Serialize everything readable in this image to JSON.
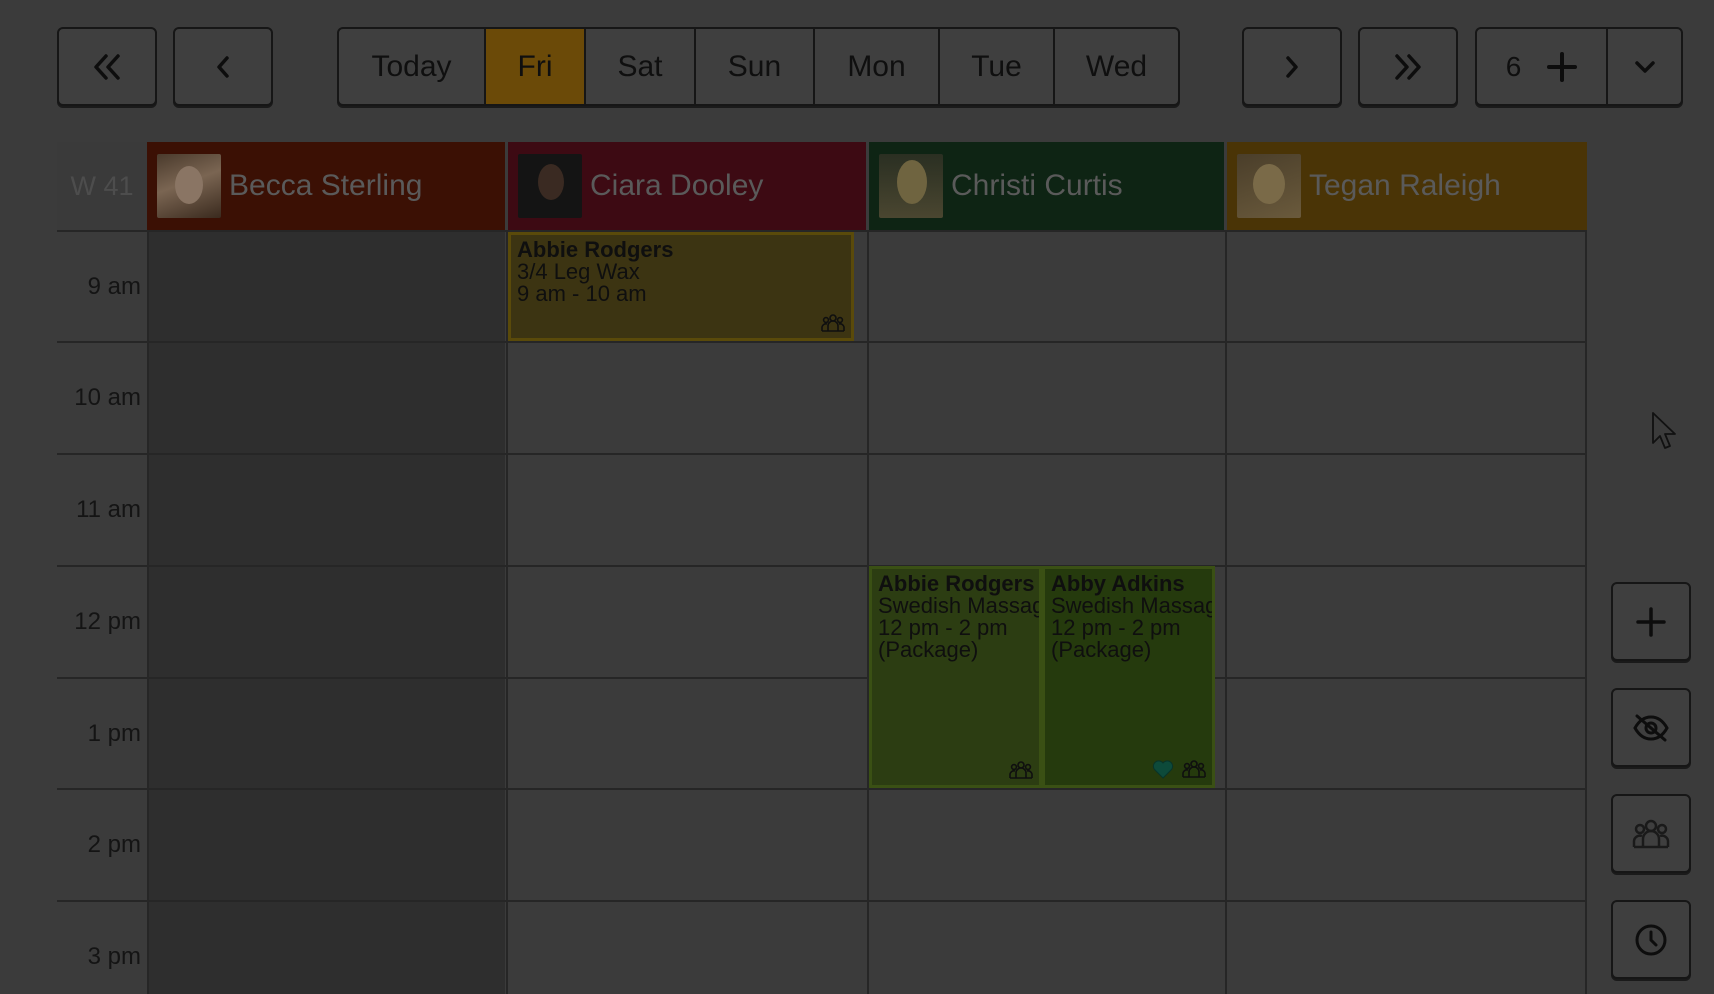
{
  "toolbar": {
    "first_icon": "double-chevron-left-icon",
    "prev_icon": "chevron-left-icon",
    "next_icon": "chevron-right-icon",
    "last_icon": "double-chevron-right-icon",
    "days": [
      {
        "label": "Today",
        "active": false
      },
      {
        "label": "Fri",
        "active": true
      },
      {
        "label": "Sat",
        "active": false
      },
      {
        "label": "Sun",
        "active": false
      },
      {
        "label": "Mon",
        "active": false
      },
      {
        "label": "Tue",
        "active": false
      },
      {
        "label": "Wed",
        "active": false
      }
    ],
    "day_count": "6",
    "add_icon": "plus-icon",
    "dropdown_icon": "chevron-down-icon"
  },
  "calendar": {
    "week_label": "W 41",
    "staff": [
      {
        "name": "Becca Sterling",
        "color": "#3b1004"
      },
      {
        "name": "Ciara Dooley",
        "color": "#3d0a13"
      },
      {
        "name": "Christi Curtis",
        "color": "#0e2414"
      },
      {
        "name": "Tegan Raleigh",
        "color": "#4a3406"
      }
    ],
    "times": [
      "9 am",
      "10 am",
      "11 am",
      "12 pm",
      "1 pm",
      "2 pm",
      "3 pm"
    ],
    "appointments": [
      {
        "client": "Abbie Rodgers",
        "service": "3/4 Leg Wax",
        "time": "9 am - 10 am",
        "note": "",
        "bg": "#3c3412",
        "border": "#5a4a0a",
        "icons": [
          "group-icon"
        ]
      },
      {
        "client": "Abbie Rodgers",
        "service": "Swedish Massage",
        "time": "12 pm - 2 pm",
        "note": "(Package)",
        "bg": "#2c3d12",
        "border": "#3a5014",
        "icons": [
          "group-icon"
        ]
      },
      {
        "client": "Abby Adkins",
        "service": "Swedish Massage",
        "time": "12 pm - 2 pm",
        "note": "(Package)",
        "bg": "#253a0d",
        "border": "#3a5014",
        "icons": [
          "heart-icon",
          "group-icon"
        ]
      }
    ]
  },
  "side_actions": [
    {
      "name": "add-appointment-button",
      "icon": "plus-icon"
    },
    {
      "name": "hide-button",
      "icon": "eye-off-icon"
    },
    {
      "name": "group-button",
      "icon": "group-icon"
    },
    {
      "name": "clock-button",
      "icon": "clock-icon"
    }
  ]
}
